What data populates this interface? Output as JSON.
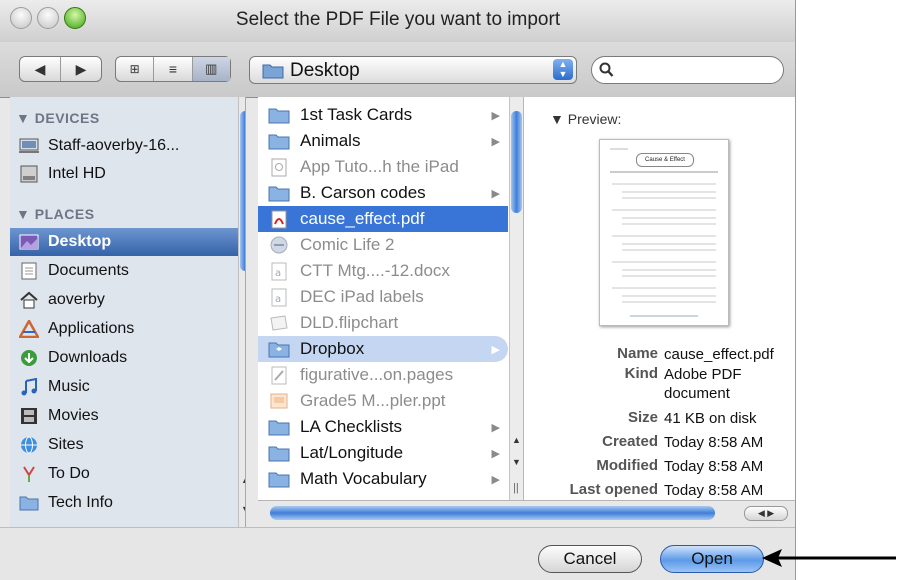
{
  "window": {
    "title": "Select the PDF File you want to import"
  },
  "toolbar": {
    "location": "Desktop",
    "search_placeholder": ""
  },
  "sidebar": {
    "devices_header": "▼ DEVICES",
    "places_header": "▼ PLACES",
    "devices": [
      {
        "label": "Staff-aoverby-16...",
        "icon": "computer-icon"
      },
      {
        "label": "Intel HD",
        "icon": "hard-drive-icon"
      }
    ],
    "places": [
      {
        "label": "Desktop",
        "icon": "desktop-icon",
        "selected": true
      },
      {
        "label": "Documents",
        "icon": "documents-icon"
      },
      {
        "label": "aoverby",
        "icon": "home-icon"
      },
      {
        "label": "Applications",
        "icon": "applications-icon"
      },
      {
        "label": "Downloads",
        "icon": "downloads-icon"
      },
      {
        "label": "Music",
        "icon": "music-icon"
      },
      {
        "label": "Movies",
        "icon": "movies-icon"
      },
      {
        "label": "Sites",
        "icon": "sites-icon"
      },
      {
        "label": "To Do",
        "icon": "todo-icon"
      },
      {
        "label": "Tech Info",
        "icon": "folder-icon"
      }
    ]
  },
  "files": [
    {
      "label": "1st Task Cards",
      "icon": "folder-icon",
      "arrow": true
    },
    {
      "label": "Animals",
      "icon": "folder-icon",
      "arrow": true
    },
    {
      "label": "App Tuto...h the iPad",
      "icon": "document-icon",
      "dim": true
    },
    {
      "label": "B. Carson codes",
      "icon": "folder-icon",
      "arrow": true
    },
    {
      "label": "cause_effect.pdf",
      "icon": "pdf-icon",
      "selected": true
    },
    {
      "label": "Comic Life 2",
      "icon": "app-icon",
      "dim": true
    },
    {
      "label": "CTT Mtg....-12.docx",
      "icon": "docx-icon",
      "dim": true
    },
    {
      "label": "DEC iPad labels",
      "icon": "docx-icon",
      "dim": true
    },
    {
      "label": "DLD.flipchart",
      "icon": "flipchart-icon",
      "dim": true
    },
    {
      "label": "Dropbox",
      "icon": "dropbox-folder-icon",
      "arrow": true,
      "highlight": true
    },
    {
      "label": "figurative...on.pages",
      "icon": "pages-icon",
      "dim": true
    },
    {
      "label": "Grade5 M...pler.ppt",
      "icon": "ppt-icon",
      "dim": true
    },
    {
      "label": "LA Checklists",
      "icon": "folder-icon",
      "arrow": true
    },
    {
      "label": "Lat/Longitude",
      "icon": "folder-icon",
      "arrow": true
    },
    {
      "label": "Math Vocabulary",
      "icon": "folder-icon",
      "arrow": true
    }
  ],
  "preview": {
    "header": "▼ Preview:",
    "thumbnail_title": "Cause & Effect",
    "meta": [
      {
        "key": "Name",
        "value": "cause_effect.pdf"
      },
      {
        "key": "Kind",
        "value": "Adobe PDF document"
      },
      {
        "key": "Size",
        "value": "41 KB on disk"
      },
      {
        "key": "Created",
        "value": "Today 8:58 AM"
      },
      {
        "key": "Modified",
        "value": "Today 8:58 AM"
      },
      {
        "key": "Last opened",
        "value": "Today 8:58 AM"
      }
    ]
  },
  "buttons": {
    "cancel": "Cancel",
    "open": "Open"
  },
  "colors": {
    "selection": "#3875d7",
    "sidebar_bg": "#dfe5ed",
    "open_button": "#5c9ae8"
  }
}
